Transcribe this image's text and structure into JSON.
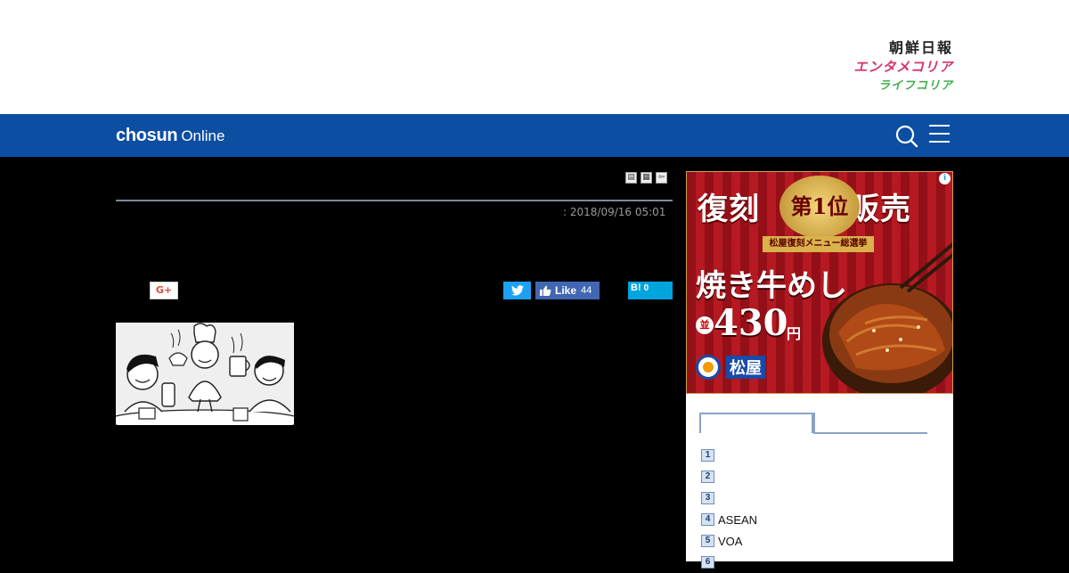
{
  "masthead": {
    "brand_1": "朝鮮日報",
    "brand_2": "エンタメコリア",
    "brand_3": "ライフコリア"
  },
  "nav": {
    "logo_main": "chosun",
    "logo_sub": "Online",
    "search_icon": "search-icon",
    "menu_icon": "hamburger-menu-icon",
    "bar_color": "#0b4ea2"
  },
  "article": {
    "date": ": 2018/09/16 05:01",
    "tools": [
      "print-icon",
      "copy-icon",
      "back-icon"
    ],
    "share": {
      "gplus_label": "G+",
      "like_label": "Like",
      "like_count": "44",
      "hatena_label": "B!",
      "hatena_count": "0"
    }
  },
  "ad": {
    "headline_left": "復刻",
    "badge": "第1位",
    "headline_right": "販売",
    "ribbon": "松屋復刻メニュー総選挙",
    "product": "焼き牛めし",
    "size": "並",
    "price": "430",
    "price_unit": "円",
    "store": "松屋",
    "info_label": "i"
  },
  "ranking": {
    "items": [
      {
        "num": "1",
        "text": ""
      },
      {
        "num": "2",
        "text": ""
      },
      {
        "num": "3",
        "text": ""
      },
      {
        "num": "4",
        "text": "ASEAN"
      },
      {
        "num": "5",
        "text": "VOA"
      },
      {
        "num": "6",
        "text": ""
      }
    ]
  }
}
